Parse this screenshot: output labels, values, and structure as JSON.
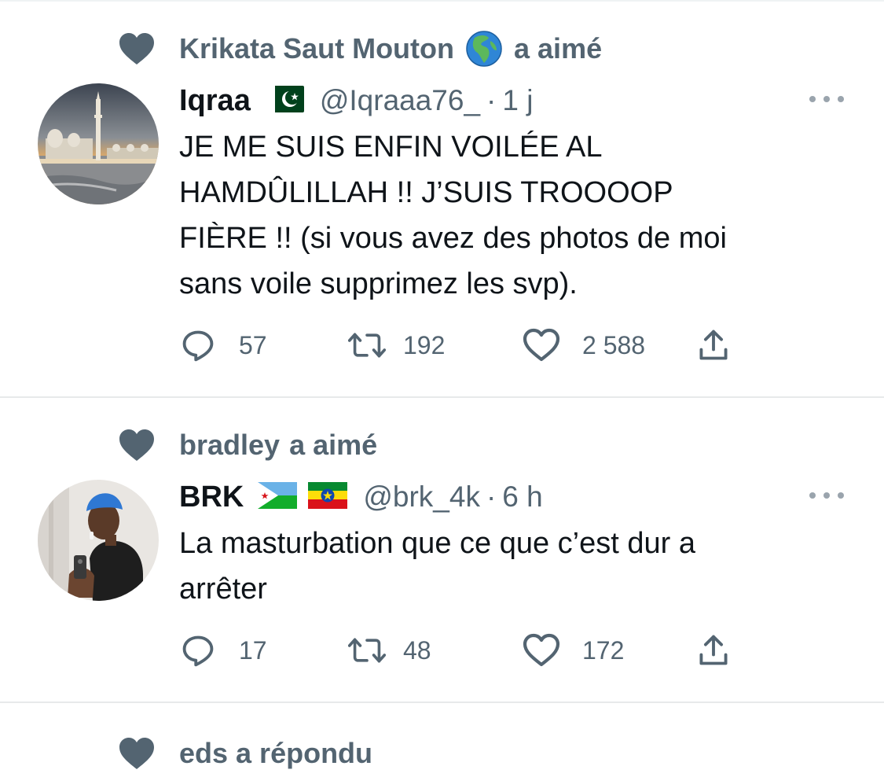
{
  "colors": {
    "text": "#0f1419",
    "muted": "#536471",
    "divider": "#e7e9ea"
  },
  "tweets": [
    {
      "social_user": "Krikata Saut Mouton",
      "social_emoji": "earth-globe-africa-europe",
      "social_action": "a aimé",
      "name": "Iqraa",
      "flags": [
        "pakistan-flag"
      ],
      "handle": "@Iqraaa76_",
      "separator": "·",
      "time": "1 j",
      "text": "JE ME SUIS ENFIN VOILÉE AL\nHAMDÛLILLAH !! J’SUIS TROOOOP\nFIÈRE !! (si vous avez des photos de moi\nsans voile supprimez les svp).",
      "replies": "57",
      "retweets": "192",
      "likes": "2 588"
    },
    {
      "social_user": "bradley",
      "social_action": "a aimé",
      "name": "BRK",
      "flags": [
        "djibouti-flag",
        "ethiopia-flag"
      ],
      "handle": "@brk_4k",
      "separator": "·",
      "time": "6 h",
      "text": "La masturbation que ce que c’est dur a\narrêter",
      "replies": "17",
      "retweets": "48",
      "likes": "172"
    }
  ],
  "partial_next": {
    "label": "eds a répondu"
  }
}
